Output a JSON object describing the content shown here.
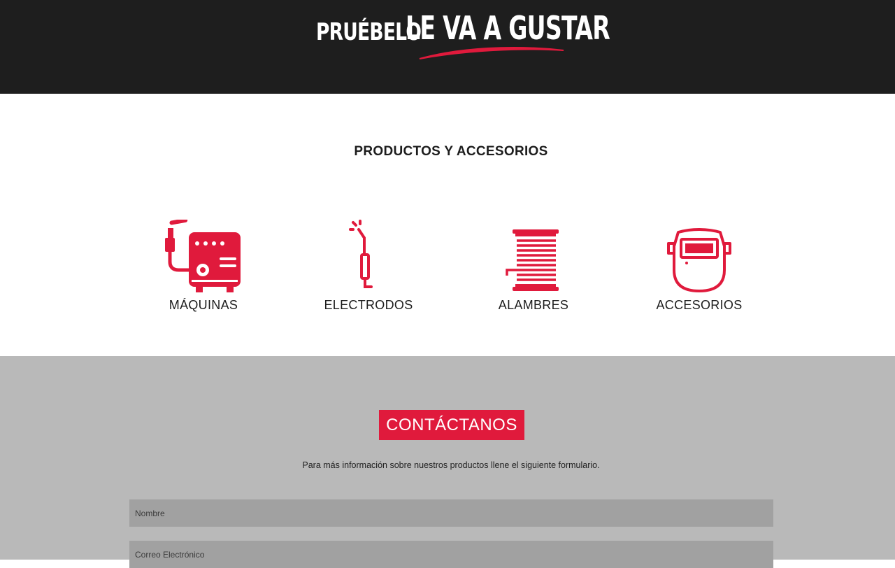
{
  "hero": {
    "slogan_small": "PRUÉBELO",
    "slogan_big": "LE VA A GUSTAR",
    "background_color": "#1e1e1e",
    "accent_color": "#e01a3c"
  },
  "products": {
    "title": "PRODUCTOS Y ACCESORIOS",
    "items": [
      {
        "label": "MÁQUINAS",
        "icon": "welding-machine-icon"
      },
      {
        "label": "ELECTRODOS",
        "icon": "electrode-icon"
      },
      {
        "label": "ALAMBRES",
        "icon": "wire-spool-icon"
      },
      {
        "label": "ACCESORIOS",
        "icon": "welding-mask-icon"
      }
    ],
    "icon_color": "#e01a3c"
  },
  "contact": {
    "badge": "CONTÁCTANOS",
    "description": "Para más información sobre nuestros productos llene el siguiente formulario.",
    "fields": [
      {
        "placeholder": "Nombre"
      },
      {
        "placeholder": "Correo Electrónico"
      }
    ],
    "background_color": "#b9b9b9"
  }
}
